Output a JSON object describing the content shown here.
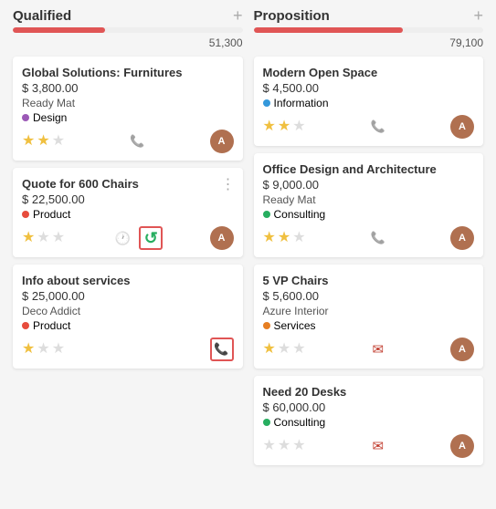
{
  "columns": [
    {
      "id": "qualified",
      "title": "Qualified",
      "total": "51,300",
      "progress_pct": 40,
      "cards": [
        {
          "id": "card1",
          "title": "Global Solutions: Furnitures",
          "amount": "$ 3,800.00",
          "company": "Ready Mat",
          "tag": "Design",
          "tag_color": "#9b59b6",
          "stars": 2,
          "star_max": 3,
          "icons": [
            "phone"
          ],
          "has_avatar": true,
          "highlight": ""
        },
        {
          "id": "card2",
          "title": "Quote for 600 Chairs",
          "amount": "$ 22,500.00",
          "company": "",
          "tag": "Product",
          "tag_color": "#e74c3c",
          "stars": 1,
          "star_max": 3,
          "icons": [
            "clock",
            "activity"
          ],
          "has_avatar": true,
          "highlight": "activity",
          "has_menu": true
        },
        {
          "id": "card3",
          "title": "Info about services",
          "amount": "$ 25,000.00",
          "company": "Deco Addict",
          "tag": "Product",
          "tag_color": "#e74c3c",
          "stars": 1,
          "star_max": 3,
          "icons": [
            "phone"
          ],
          "has_avatar": false,
          "highlight": "phone"
        }
      ]
    },
    {
      "id": "proposition",
      "title": "Proposition",
      "total": "79,100",
      "progress_pct": 65,
      "cards": [
        {
          "id": "card4",
          "title": "Modern Open Space",
          "amount": "$ 4,500.00",
          "company": "",
          "tag": "Information",
          "tag_color": "#3498db",
          "stars": 2,
          "star_max": 3,
          "icons": [
            "phone"
          ],
          "has_avatar": true,
          "highlight": ""
        },
        {
          "id": "card5",
          "title": "Office Design and Architecture",
          "amount": "$ 9,000.00",
          "company": "Ready Mat",
          "tag": "Consulting",
          "tag_color": "#27ae60",
          "stars": 2,
          "star_max": 3,
          "icons": [
            "phone"
          ],
          "has_avatar": true,
          "highlight": ""
        },
        {
          "id": "card6",
          "title": "5 VP Chairs",
          "amount": "$ 5,600.00",
          "company": "Azure Interior",
          "tag": "Services",
          "tag_color": "#e67e22",
          "stars": 1,
          "star_max": 3,
          "icons": [
            "email"
          ],
          "has_avatar": true,
          "highlight": ""
        },
        {
          "id": "card7",
          "title": "Need 20 Desks",
          "amount": "$ 60,000.00",
          "company": "",
          "tag": "Consulting",
          "tag_color": "#27ae60",
          "stars": 0,
          "star_max": 3,
          "icons": [
            "email"
          ],
          "has_avatar": true,
          "highlight": ""
        }
      ]
    }
  ],
  "add_label": "+",
  "avatar_initials": "A"
}
